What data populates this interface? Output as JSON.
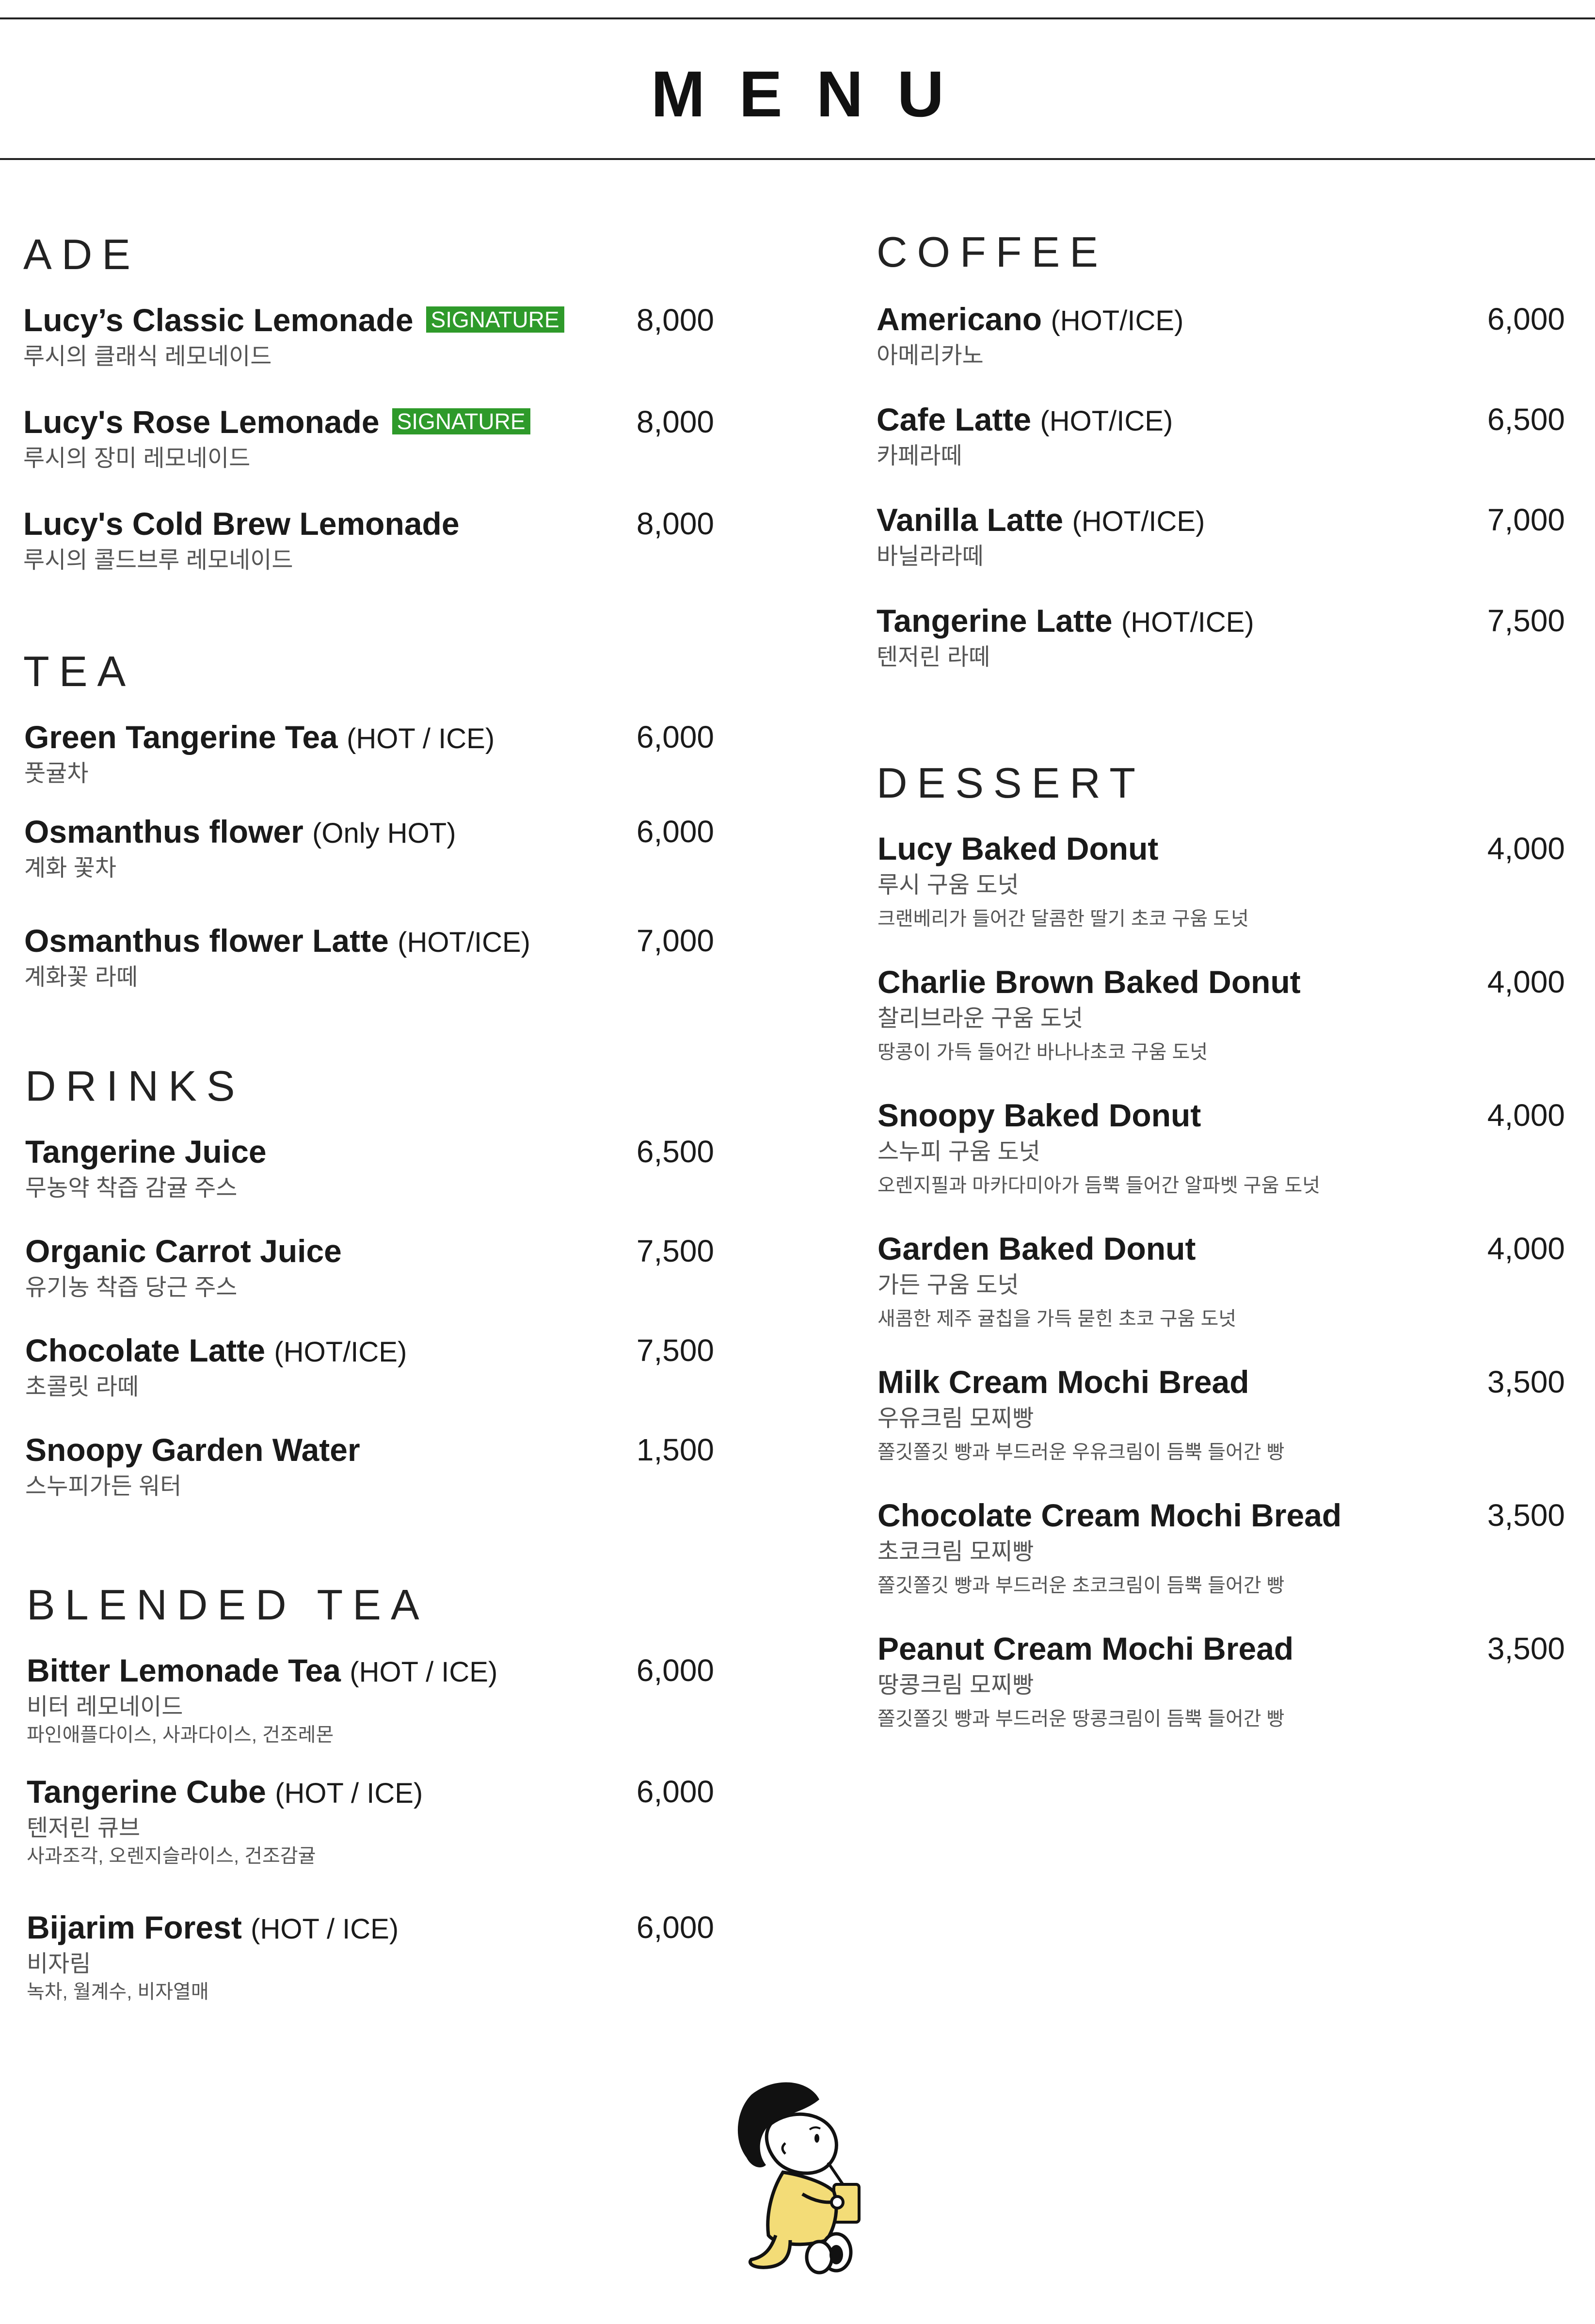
{
  "header": {
    "title": "MENU"
  },
  "sections": {
    "ade": {
      "title": "ADE",
      "items": [
        {
          "name": "Lucy’s Classic Lemonade",
          "badge": "SIGNATURE",
          "price": "8,000",
          "sub": "루시의 클래식 레모네이드"
        },
        {
          "name": "Lucy's Rose Lemonade",
          "badge": "SIGNATURE",
          "price": "8,000",
          "sub": "루시의 장미 레모네이드"
        },
        {
          "name": "Lucy's Cold Brew Lemonade",
          "price": "8,000",
          "sub": "루시의 콜드브루 레모네이드"
        }
      ]
    },
    "tea": {
      "title": "TEA",
      "items": [
        {
          "name": "Green Tangerine Tea",
          "suffix": "(HOT / ICE)",
          "price": "6,000",
          "sub": "풋귤차"
        },
        {
          "name": "Osmanthus flower",
          "suffix": "(Only HOT)",
          "price": "6,000",
          "sub": "계화 꽃차"
        },
        {
          "name": "Osmanthus flower Latte",
          "suffix": "(HOT/ICE)",
          "price": "7,000",
          "sub": "계화꽃 라떼"
        }
      ]
    },
    "drinks": {
      "title": "DRINKS",
      "items": [
        {
          "name": "Tangerine Juice",
          "price": "6,500",
          "sub": "무농약 착즙 감귤 주스"
        },
        {
          "name": "Organic Carrot Juice",
          "price": "7,500",
          "sub": "유기농 착즙 당근 주스"
        },
        {
          "name": "Chocolate Latte",
          "suffix": "(HOT/ICE)",
          "price": "7,500",
          "sub": "초콜릿 라떼"
        },
        {
          "name": "Snoopy Garden Water",
          "price": "1,500",
          "sub": "스누피가든 워터"
        }
      ]
    },
    "blended_tea": {
      "title": "BLENDED TEA",
      "items": [
        {
          "name": "Bitter Lemonade Tea",
          "suffix": "(HOT / ICE)",
          "price": "6,000",
          "sub": "비터 레모네이드",
          "desc": "파인애플다이스, 사과다이스, 건조레몬"
        },
        {
          "name": "Tangerine Cube",
          "suffix": "(HOT / ICE)",
          "price": "6,000",
          "sub": "텐저린 큐브",
          "desc": "사과조각, 오렌지슬라이스, 건조감귤"
        },
        {
          "name": "Bijarim Forest",
          "suffix": "(HOT / ICE)",
          "price": "6,000",
          "sub": "비자림",
          "desc": "녹차, 월계수, 비자열매"
        }
      ]
    },
    "coffee": {
      "title": "COFFEE",
      "items": [
        {
          "name": "Americano",
          "suffix": "(HOT/ICE)",
          "price": "6,000",
          "sub": "아메리카노"
        },
        {
          "name": "Cafe Latte",
          "suffix": "(HOT/ICE)",
          "price": "6,500",
          "sub": "카페라떼"
        },
        {
          "name": "Vanilla Latte",
          "suffix": "(HOT/ICE)",
          "price": "7,000",
          "sub": "바닐라라떼"
        },
        {
          "name": "Tangerine Latte",
          "suffix": "(HOT/ICE)",
          "price": "7,500",
          "sub": "텐저린 라떼"
        }
      ]
    },
    "dessert": {
      "title": "DESSERT",
      "items": [
        {
          "name": "Lucy Baked Donut",
          "price": "4,000",
          "sub": "루시 구움 도넛",
          "desc": "크랜베리가 들어간 달콤한 딸기 초코 구움 도넛"
        },
        {
          "name": "Charlie Brown Baked Donut",
          "price": "4,000",
          "sub": "찰리브라운 구움 도넛",
          "desc": "땅콩이 가득 들어간 바나나초코 구움 도넛"
        },
        {
          "name": "Snoopy Baked Donut",
          "price": "4,000",
          "sub": "스누피 구움 도넛",
          "desc": "오렌지필과 마카다미아가 듬뿍 들어간 알파벳 구움 도넛"
        },
        {
          "name": "Garden Baked Donut",
          "price": "4,000",
          "sub": "가든 구움 도넛",
          "desc": "새콤한 제주 귤칩을 가득 묻힌 초코 구움 도넛"
        },
        {
          "name": "Milk Cream Mochi Bread",
          "price": "3,500",
          "sub": "우유크림 모찌빵",
          "desc": "쫄깃쫄깃 빵과 부드러운 우유크림이 듬뿍 들어간 빵"
        },
        {
          "name": "Chocolate Cream Mochi Bread",
          "price": "3,500",
          "sub": "초코크림 모찌빵",
          "desc": "쫄깃쫄깃 빵과 부드러운 초코크림이 듬뿍 들어간 빵"
        },
        {
          "name": "Peanut Cream Mochi Bread",
          "price": "3,500",
          "sub": "땅콩크림 모찌빵",
          "desc": "쫄깃쫄깃 빵과 부드러운 땅콩크림이 듬뿍 들어간 빵"
        }
      ]
    }
  },
  "colors": {
    "signature_badge": "#2e9a2a",
    "text": "#1a1a1a",
    "subtext": "#555555"
  },
  "illustration": {
    "icon": "lucy-drinking-icon"
  }
}
